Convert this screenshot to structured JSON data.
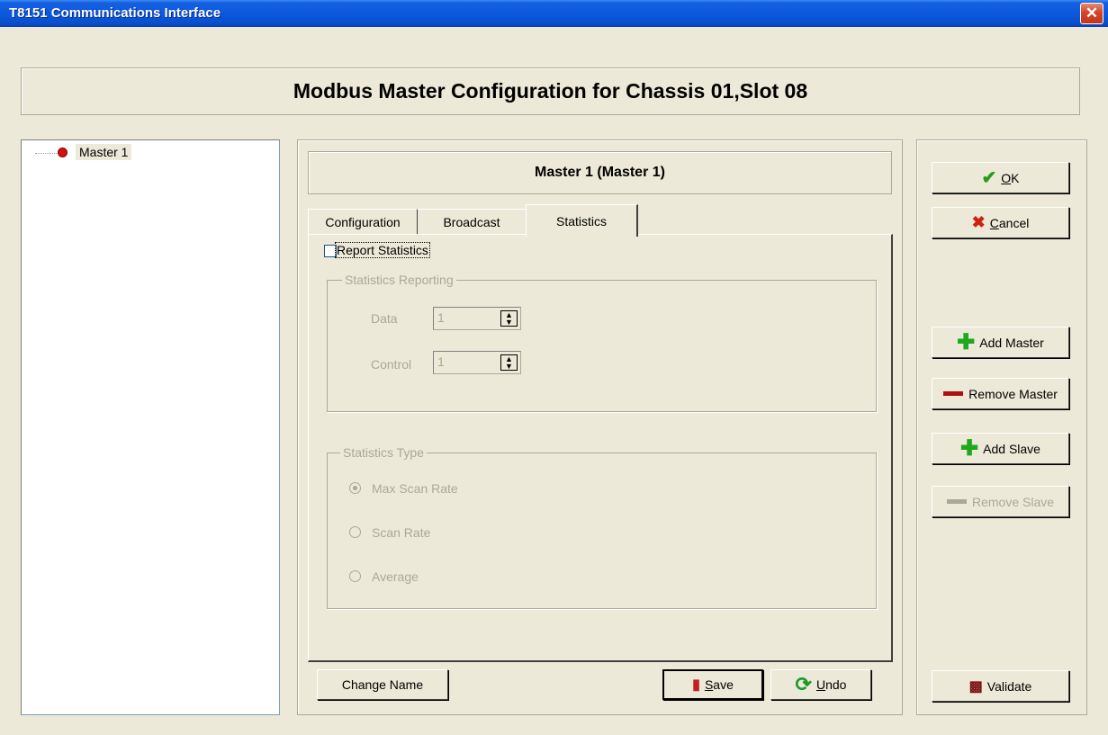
{
  "window": {
    "title": "T8151 Communications Interface",
    "close_glyph": "✕"
  },
  "header": {
    "title": "Modbus Master Configuration for Chassis 01,Slot 08"
  },
  "tree": {
    "items": [
      {
        "label": "Master 1",
        "icon": "red-dot-icon"
      }
    ]
  },
  "master_panel": {
    "title": "Master 1 (Master 1)"
  },
  "tabs": [
    {
      "label": "Configuration",
      "selected": false
    },
    {
      "label": "Broadcast",
      "selected": false
    },
    {
      "label": "Statistics",
      "selected": true
    }
  ],
  "statistics": {
    "report_checkbox": {
      "label": "Report Statistics",
      "checked": false
    },
    "reporting_group": {
      "legend": "Statistics Reporting",
      "data_label": "Data",
      "data_value": "1",
      "control_label": "Control",
      "control_value": "1"
    },
    "type_group": {
      "legend": "Statistics Type",
      "options": [
        {
          "label": "Max Scan Rate",
          "selected": true
        },
        {
          "label": "Scan Rate",
          "selected": false
        },
        {
          "label": "Average",
          "selected": false
        }
      ]
    }
  },
  "bottom_buttons": {
    "change_name": "Change Name",
    "save_accel": "S",
    "save_rest": "ave",
    "undo_accel": "U",
    "undo_rest": "ndo"
  },
  "right_buttons": {
    "ok_accel": "O",
    "ok_rest": "K",
    "cancel_accel": "C",
    "cancel_rest": "ancel",
    "add_master": "Add Master",
    "remove_master": "Remove Master",
    "add_slave": "Add Slave",
    "remove_slave": "Remove Slave",
    "validate": "Validate"
  },
  "icons": {
    "ok": "✔",
    "cancel": "✖",
    "plus": "✚",
    "undo": "⟳",
    "save": "▮",
    "validate": "▩",
    "spin_up": "▲",
    "spin_down": "▼"
  },
  "colors": {
    "titlebar": "#0b58df",
    "face": "#ece9d8",
    "disabled_text": "#aca899"
  }
}
